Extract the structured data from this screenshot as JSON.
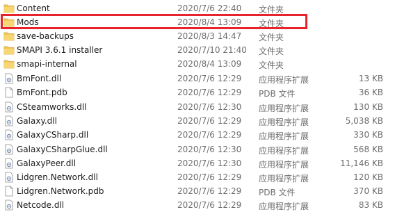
{
  "accent": {
    "highlight": "#e8232b",
    "folder": "#f2c75c",
    "dll_icon": "#7a8fb0"
  },
  "files": [
    {
      "name": "Content",
      "date": "2020/7/6 22:40",
      "type": "文件夹",
      "size": "",
      "icon": "folder-icon"
    },
    {
      "name": "Mods",
      "date": "2020/8/4 13:09",
      "type": "文件夹",
      "size": "",
      "icon": "folder-icon"
    },
    {
      "name": "save-backups",
      "date": "2020/8/3 14:47",
      "type": "文件夹",
      "size": "",
      "icon": "folder-icon"
    },
    {
      "name": "SMAPI 3.6.1 installer",
      "date": "2020/7/10 21:40",
      "type": "文件夹",
      "size": "",
      "icon": "folder-icon"
    },
    {
      "name": "smapi-internal",
      "date": "2020/8/4 13:09",
      "type": "文件夹",
      "size": "",
      "icon": "folder-icon"
    },
    {
      "name": "BmFont.dll",
      "date": "2020/7/6 12:29",
      "type": "应用程序扩展",
      "size": "13 KB",
      "icon": "dll-file-icon"
    },
    {
      "name": "BmFont.pdb",
      "date": "2020/7/6 12:29",
      "type": "PDB 文件",
      "size": "36 KB",
      "icon": "file-icon"
    },
    {
      "name": "CSteamworks.dll",
      "date": "2020/7/6 12:30",
      "type": "应用程序扩展",
      "size": "130 KB",
      "icon": "dll-file-icon"
    },
    {
      "name": "Galaxy.dll",
      "date": "2020/7/6 12:29",
      "type": "应用程序扩展",
      "size": "5,038 KB",
      "icon": "dll-file-icon"
    },
    {
      "name": "GalaxyCSharp.dll",
      "date": "2020/7/6 12:29",
      "type": "应用程序扩展",
      "size": "330 KB",
      "icon": "dll-file-icon"
    },
    {
      "name": "GalaxyCSharpGlue.dll",
      "date": "2020/7/6 12:30",
      "type": "应用程序扩展",
      "size": "568 KB",
      "icon": "dll-file-icon"
    },
    {
      "name": "GalaxyPeer.dll",
      "date": "2020/7/6 12:30",
      "type": "应用程序扩展",
      "size": "11,146 KB",
      "icon": "dll-file-icon"
    },
    {
      "name": "Lidgren.Network.dll",
      "date": "2020/7/6 12:29",
      "type": "应用程序扩展",
      "size": "120 KB",
      "icon": "dll-file-icon"
    },
    {
      "name": "Lidgren.Network.pdb",
      "date": "2020/7/6 12:29",
      "type": "PDB 文件",
      "size": "370 KB",
      "icon": "file-icon"
    },
    {
      "name": "Netcode.dll",
      "date": "2020/7/6 12:29",
      "type": "应用程序扩展",
      "size": "83 KB",
      "icon": "dll-file-icon"
    }
  ]
}
